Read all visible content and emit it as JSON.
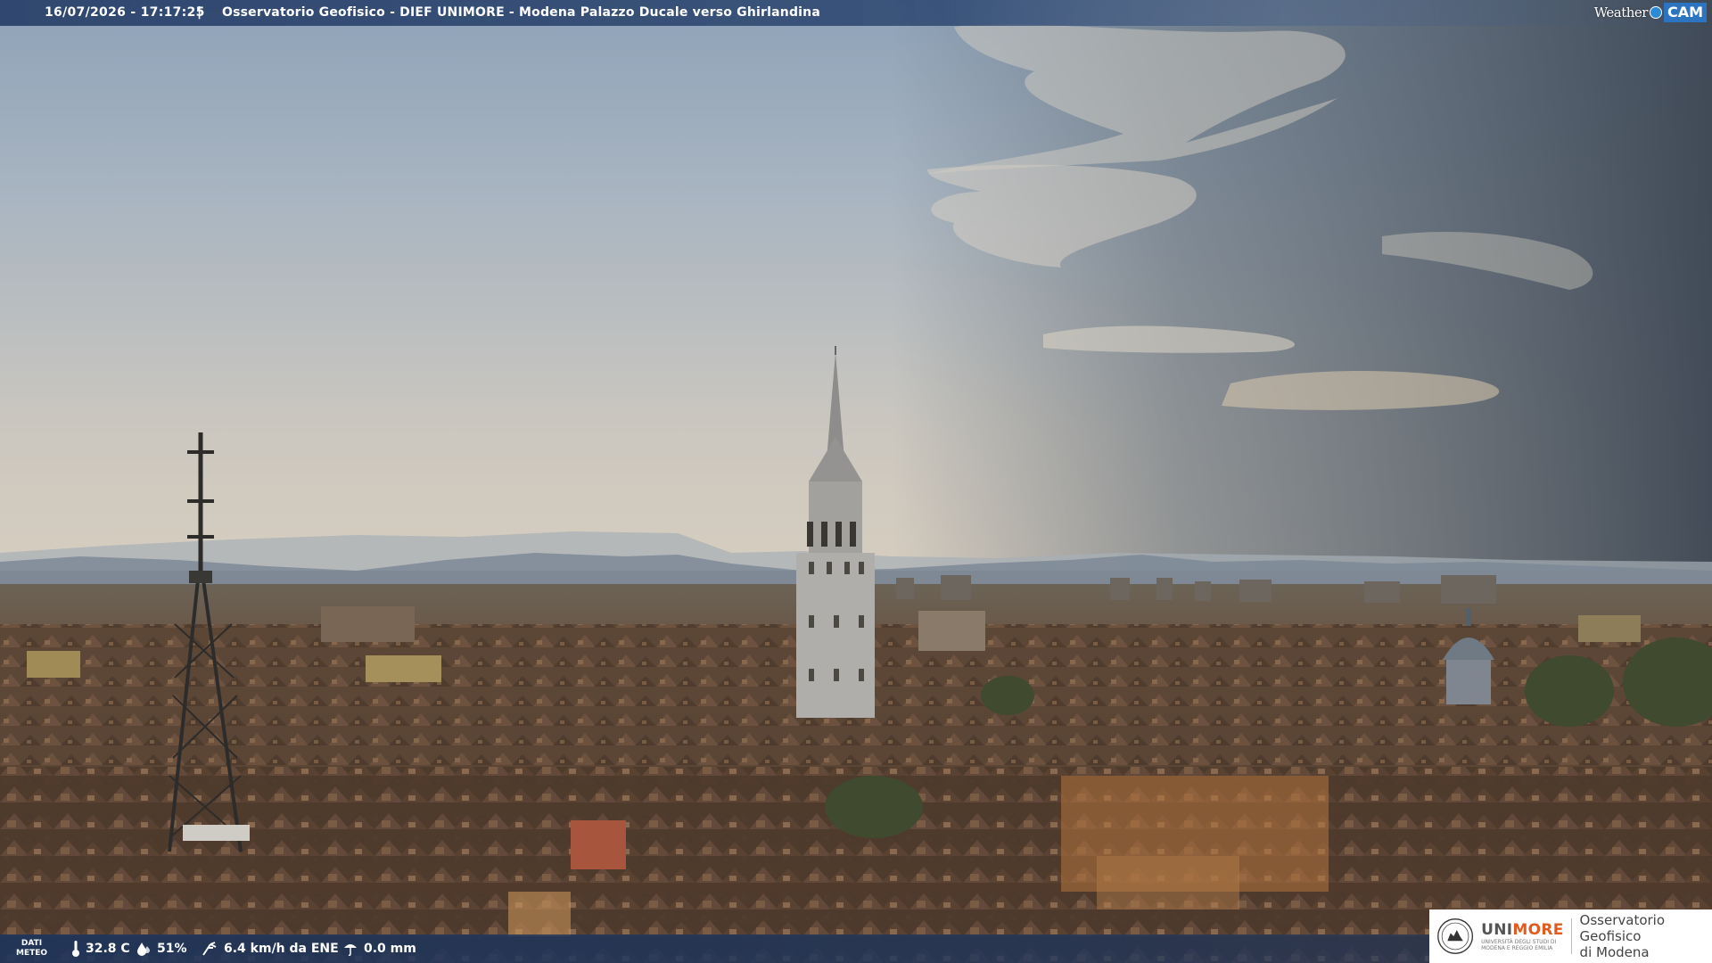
{
  "header": {
    "timestamp": "16/07/2026 - 17:17:25",
    "separator": "|",
    "title": "Osservatorio Geofisico - DIEF UNIMORE - Modena Palazzo Ducale verso Ghirlandina"
  },
  "brand": {
    "weather": "Weather",
    "cam": "CAM"
  },
  "meteo": {
    "label_line1": "DATI",
    "label_line2": "METEO",
    "temperature": "32.8 C",
    "humidity": "51%",
    "wind": "6.4 km/h da ENE",
    "rain": "0.0 mm"
  },
  "institution": {
    "name_prefix": "UNI",
    "name_suffix": "MORE",
    "subtitle_line1": "UNIVERSITÀ DEGLI STUDI DI",
    "subtitle_line2": "MODENA E REGGIO EMILIA",
    "observatory_line1": "Osservatorio Geofisico",
    "observatory_line2": "di Modena"
  },
  "colors": {
    "bar_blue": "#284068",
    "unimore_orange": "#e25a1c",
    "sky_top": "#8fa3b8",
    "rooftops": "#5a4636"
  }
}
